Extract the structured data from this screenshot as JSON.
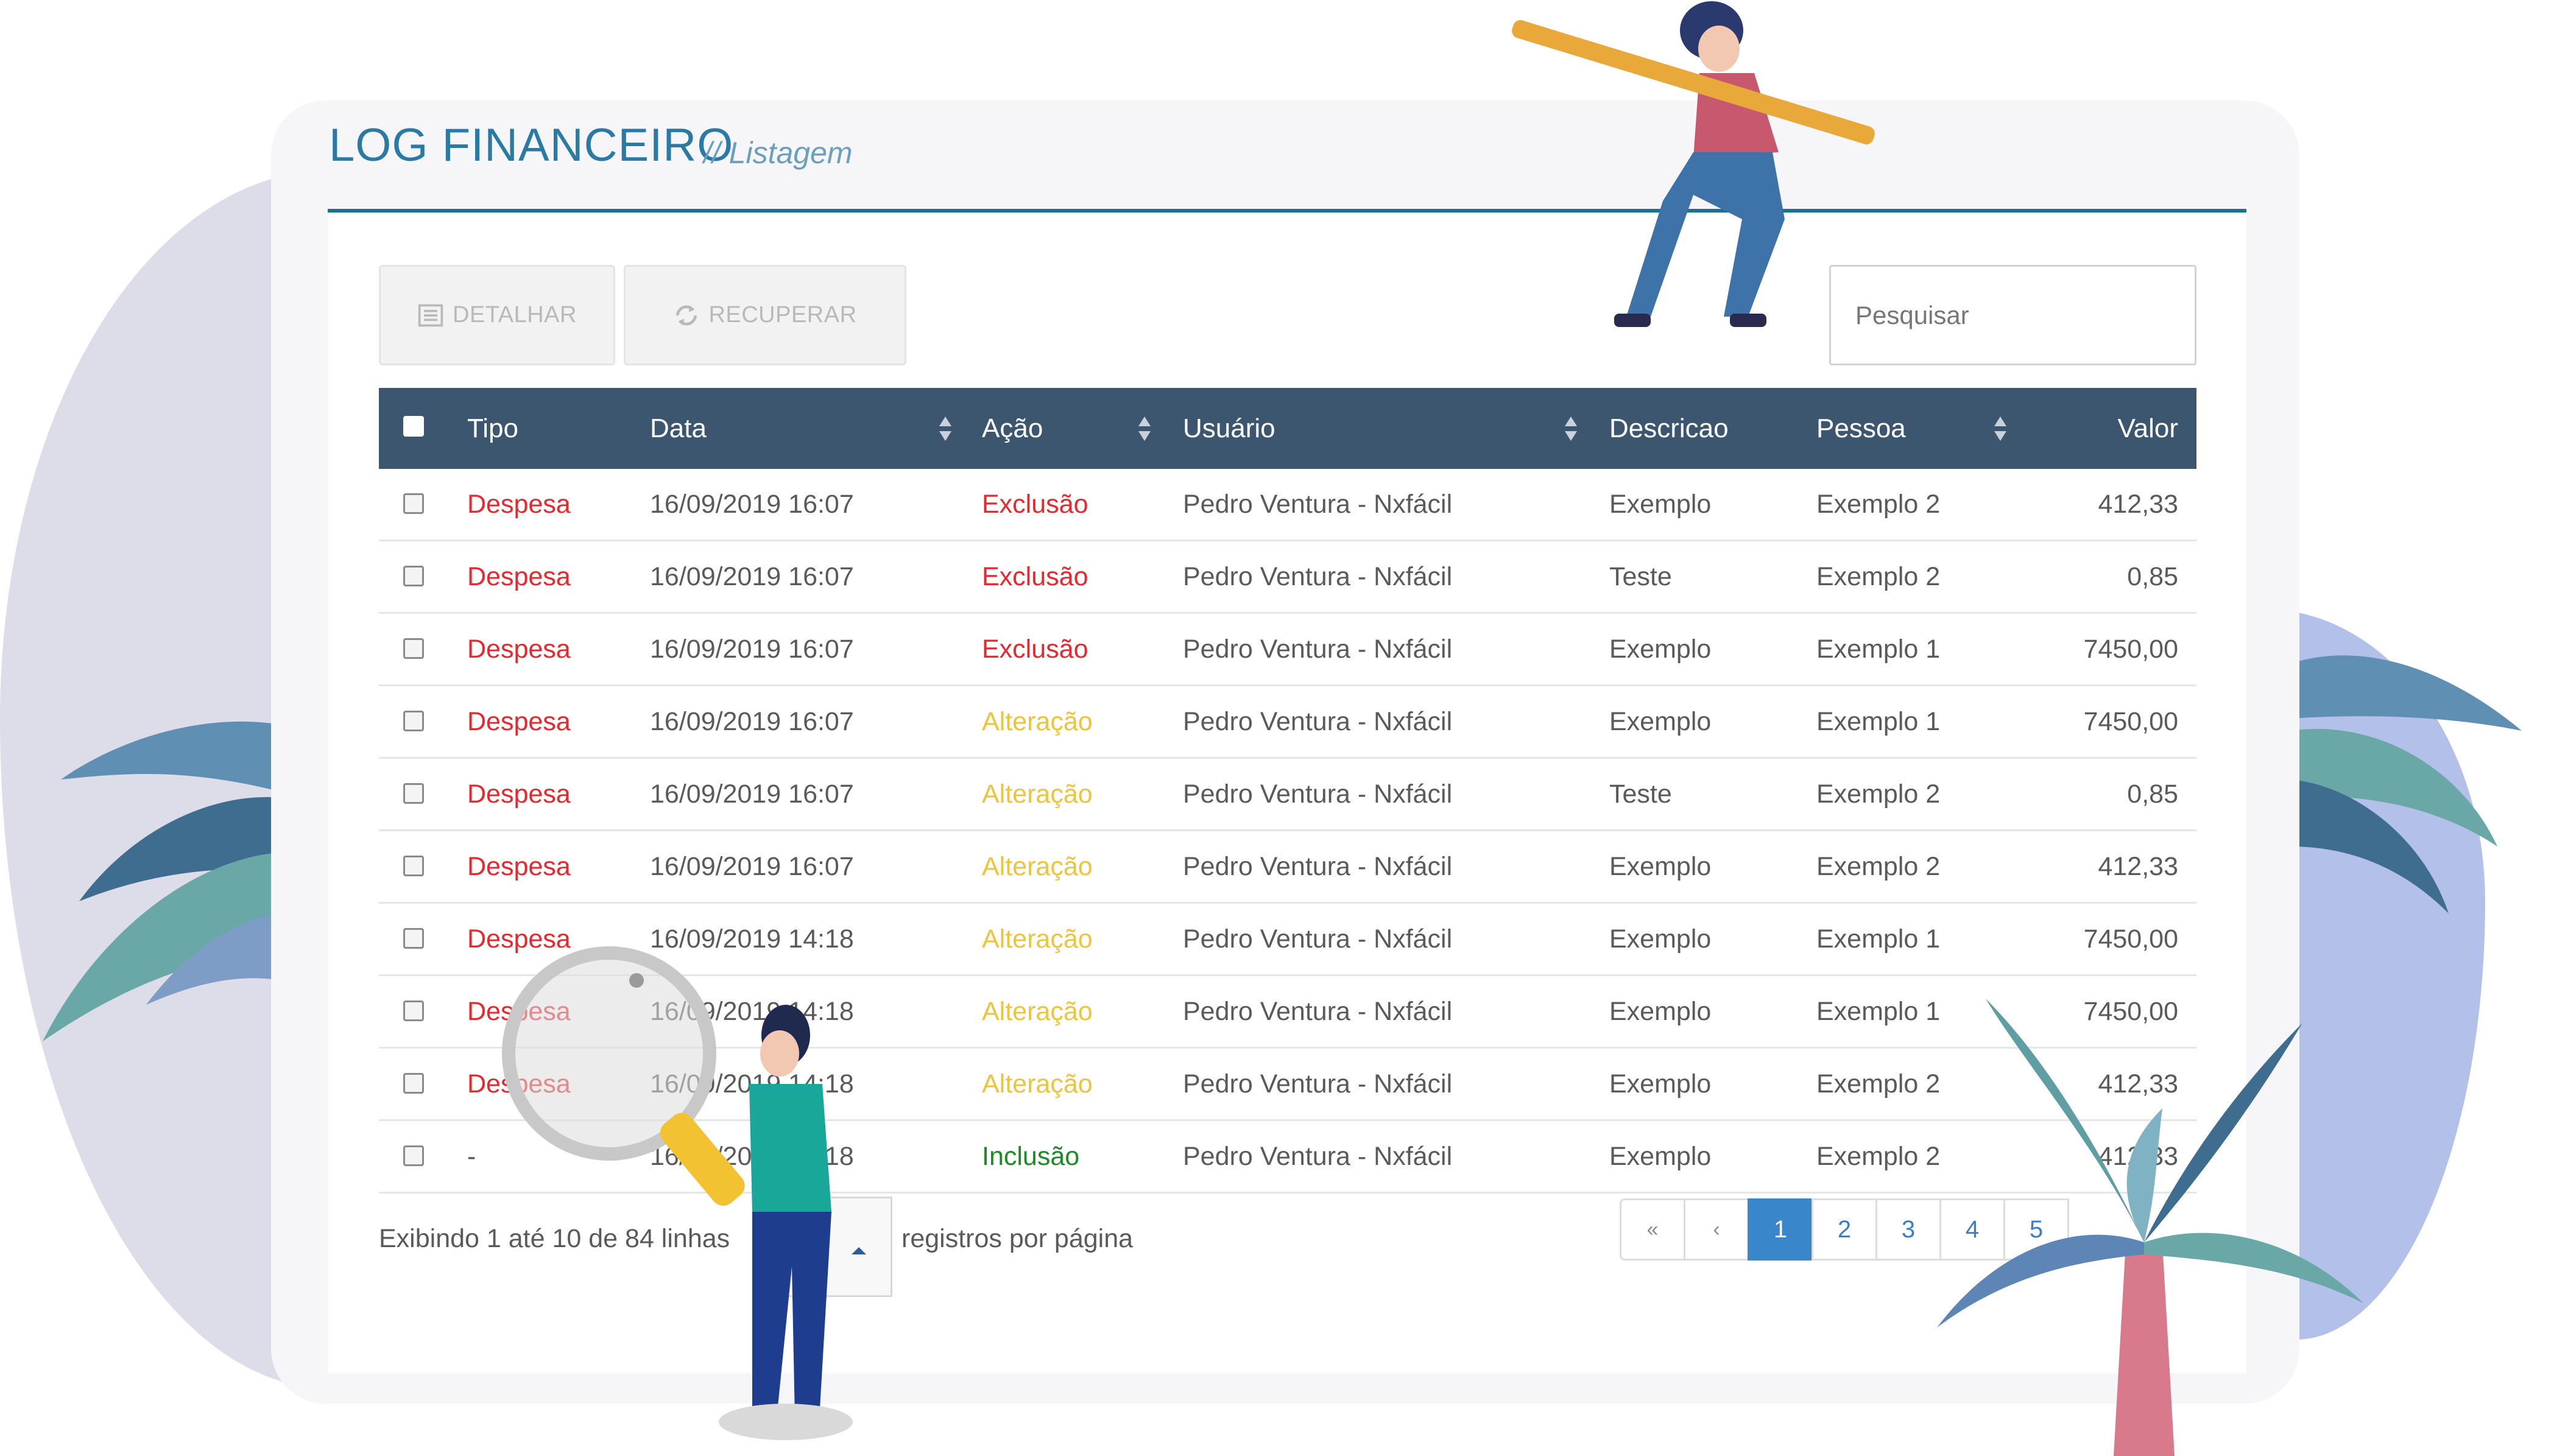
{
  "header": {
    "title": "LOG FINANCEIRO",
    "subtitle": "// Listagem"
  },
  "toolbar": {
    "detalhar_label": "DETALHAR",
    "detalhar_icon": "list-icon",
    "recuperar_label": "RECUPERAR",
    "recuperar_icon": "refresh-icon"
  },
  "search": {
    "placeholder": "Pesquisar",
    "value": ""
  },
  "table": {
    "columns": [
      "Tipo",
      "Data",
      "Ação",
      "Usuário",
      "Descricao",
      "Pessoa",
      "Valor"
    ],
    "rows": [
      {
        "tipo": "Despesa",
        "data": "16/09/2019 16:07",
        "acao": "Exclusão",
        "usuario": "Pedro Ventura - Nxfácil",
        "descricao": "Exemplo",
        "pessoa": "Exemplo 2",
        "valor": "412,33"
      },
      {
        "tipo": "Despesa",
        "data": "16/09/2019 16:07",
        "acao": "Exclusão",
        "usuario": "Pedro Ventura - Nxfácil",
        "descricao": "Teste",
        "pessoa": "Exemplo 2",
        "valor": "0,85"
      },
      {
        "tipo": "Despesa",
        "data": "16/09/2019 16:07",
        "acao": "Exclusão",
        "usuario": "Pedro Ventura - Nxfácil",
        "descricao": "Exemplo",
        "pessoa": "Exemplo 1",
        "valor": "7450,00"
      },
      {
        "tipo": "Despesa",
        "data": "16/09/2019 16:07",
        "acao": "Alteração",
        "usuario": "Pedro Ventura - Nxfácil",
        "descricao": "Exemplo",
        "pessoa": "Exemplo 1",
        "valor": "7450,00"
      },
      {
        "tipo": "Despesa",
        "data": "16/09/2019 16:07",
        "acao": "Alteração",
        "usuario": "Pedro Ventura - Nxfácil",
        "descricao": "Teste",
        "pessoa": "Exemplo 2",
        "valor": "0,85"
      },
      {
        "tipo": "Despesa",
        "data": "16/09/2019 16:07",
        "acao": "Alteração",
        "usuario": "Pedro Ventura - Nxfácil",
        "descricao": "Exemplo",
        "pessoa": "Exemplo 2",
        "valor": "412,33"
      },
      {
        "tipo": "Despesa",
        "data": "16/09/2019 14:18",
        "acao": "Alteração",
        "usuario": "Pedro Ventura - Nxfácil",
        "descricao": "Exemplo",
        "pessoa": "Exemplo 1",
        "valor": "7450,00"
      },
      {
        "tipo": "Despesa",
        "data": "16/09/2019 14:18",
        "acao": "Alteração",
        "usuario": "Pedro Ventura - Nxfácil",
        "descricao": "Exemplo",
        "pessoa": "Exemplo 1",
        "valor": "7450,00"
      },
      {
        "tipo": "Despesa",
        "data": "16/09/2019 14:18",
        "acao": "Alteração",
        "usuario": "Pedro Ventura - Nxfácil",
        "descricao": "Exemplo",
        "pessoa": "Exemplo 2",
        "valor": "412,33"
      },
      {
        "tipo": "-",
        "data": "16/09/2019 14:18",
        "acao": "Inclusão",
        "usuario": "Pedro Ventura - Nxfácil",
        "descricao": "Exemplo",
        "pessoa": "Exemplo 2",
        "valor": "412,33"
      }
    ]
  },
  "footer": {
    "info": "Exibindo 1 até 10 de 84 linhas",
    "per_page_label": "registros por página",
    "pages": [
      "«",
      "‹",
      "1",
      "2",
      "3",
      "4",
      "5"
    ]
  },
  "colors": {
    "accent": "#2a7aa6",
    "header_bg": "#3d5670",
    "despesa": "#e8282e",
    "exclusao": "#e8282e",
    "alteracao": "#eec43a",
    "inclusao": "#1e8a28",
    "page_active": "#3a86cb"
  }
}
